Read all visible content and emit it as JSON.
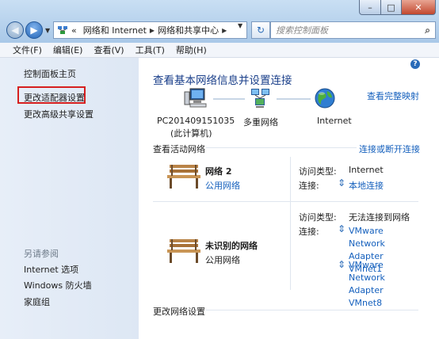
{
  "window": {
    "min": "–",
    "max": "□",
    "close": "✕"
  },
  "nav": {
    "back": "◀",
    "forward": "▶",
    "breadcrumb": [
      "«",
      "网络和 Internet",
      "网络和共享中心"
    ],
    "search_placeholder": "搜索控制面板"
  },
  "menu": [
    "文件(F)",
    "编辑(E)",
    "查看(V)",
    "工具(T)",
    "帮助(H)"
  ],
  "sidebar": {
    "items": [
      "控制面板主页",
      "更改适配器设置",
      "更改高级共享设置"
    ],
    "see_also_title": "另请参阅",
    "see_also": [
      "Internet 选项",
      "Windows 防火墙",
      "家庭组"
    ]
  },
  "main": {
    "heading": "查看基本网络信息并设置连接",
    "view_full_map": "查看完整映射",
    "map_nodes": [
      {
        "label": "PC201409151035",
        "sub": "(此计算机)",
        "icon": "computer-icon"
      },
      {
        "label": "多重网络",
        "sub": "",
        "icon": "multiple-networks-icon"
      },
      {
        "label": "Internet",
        "sub": "",
        "icon": "globe-icon"
      }
    ],
    "active_title": "查看活动网络",
    "connect_disconnect": "连接或断开连接",
    "networks": [
      {
        "name": "网络  2",
        "type": "公用网络",
        "type_is_link": true,
        "access_label": "访问类型:",
        "access_value": "Internet",
        "conn_label": "连接:",
        "connections": [
          "本地连接"
        ]
      },
      {
        "name": "未识别的网络",
        "type": "公用网络",
        "type_is_link": false,
        "access_label": "访问类型:",
        "access_value": "无法连接到网络",
        "conn_label": "连接:",
        "connections": [
          "VMware Network Adapter VMnet1",
          "VMware Network Adapter VMnet8"
        ]
      }
    ],
    "change_settings": "更改网络设置"
  },
  "colors": {
    "link": "#1560bd",
    "heading": "#1a3f8a",
    "highlight_box": "#d61f1f"
  }
}
